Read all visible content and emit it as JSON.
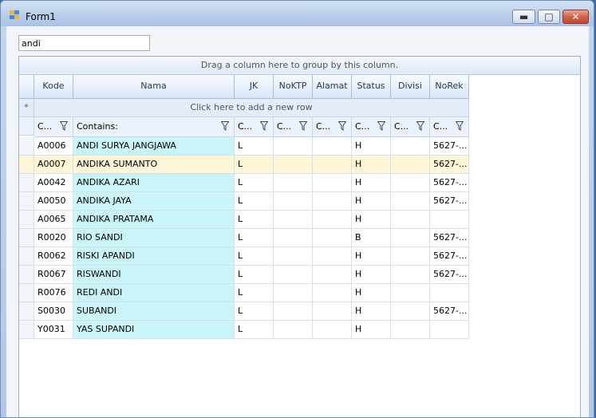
{
  "window": {
    "title": "Form1"
  },
  "search": {
    "value": "andi"
  },
  "grid": {
    "group_panel_text": "Drag a column here to group by this column.",
    "new_row_text": "Click here to add a new row",
    "new_row_marker": "*",
    "columns": [
      "Kode",
      "Nama",
      "JK",
      "NoKTP",
      "Alamat",
      "Status",
      "Divisi",
      "NoRek"
    ],
    "filter_labels": [
      "C...",
      "Contains:",
      "C...",
      "C...",
      "C...",
      "C...",
      "C...",
      "C..."
    ],
    "selected_row_index": 1,
    "rows": [
      {
        "kode": "A0006",
        "nama": "ANDI SURYA JANGJAWA",
        "jk": "L",
        "noktp": "",
        "alamat": "",
        "status": "H",
        "divisi": "",
        "norek": "5627-..."
      },
      {
        "kode": "A0007",
        "nama": "ANDIKA SUMANTO",
        "jk": "L",
        "noktp": "",
        "alamat": "",
        "status": "H",
        "divisi": "",
        "norek": "5627-..."
      },
      {
        "kode": "A0042",
        "nama": "ANDIKA AZARI",
        "jk": "L",
        "noktp": "",
        "alamat": "",
        "status": "H",
        "divisi": "",
        "norek": "5627-..."
      },
      {
        "kode": "A0050",
        "nama": "ANDIKA JAYA",
        "jk": "L",
        "noktp": "",
        "alamat": "",
        "status": "H",
        "divisi": "",
        "norek": "5627-..."
      },
      {
        "kode": "A0065",
        "nama": "ANDIKA PRATAMA",
        "jk": "L",
        "noktp": "",
        "alamat": "",
        "status": "H",
        "divisi": "",
        "norek": ""
      },
      {
        "kode": "R0020",
        "nama": "RIO SANDI",
        "jk": "L",
        "noktp": "",
        "alamat": "",
        "status": "B",
        "divisi": "",
        "norek": "5627-..."
      },
      {
        "kode": "R0062",
        "nama": "RISKI APANDI",
        "jk": "L",
        "noktp": "",
        "alamat": "",
        "status": "H",
        "divisi": "",
        "norek": "5627-..."
      },
      {
        "kode": "R0067",
        "nama": "RISWANDI",
        "jk": "L",
        "noktp": "",
        "alamat": "",
        "status": "H",
        "divisi": "",
        "norek": "5627-..."
      },
      {
        "kode": "R0076",
        "nama": "REDI ANDI",
        "jk": "L",
        "noktp": "",
        "alamat": "",
        "status": "H",
        "divisi": "",
        "norek": ""
      },
      {
        "kode": "S0030",
        "nama": "SUBANDI",
        "jk": "L",
        "noktp": "",
        "alamat": "",
        "status": "H",
        "divisi": "",
        "norek": "5627-..."
      },
      {
        "kode": "Y0031",
        "nama": "YAS SUPANDI",
        "jk": "L",
        "noktp": "",
        "alamat": "",
        "status": "H",
        "divisi": "",
        "norek": ""
      }
    ]
  },
  "colors": {
    "name_column": "#c9f5f8",
    "selected_row": "#fff6d8",
    "header": "#dbe6f5"
  },
  "icons": [
    "form-app-icon",
    "minimize-icon",
    "maximize-icon",
    "close-icon",
    "filter-funnel-icon"
  ]
}
